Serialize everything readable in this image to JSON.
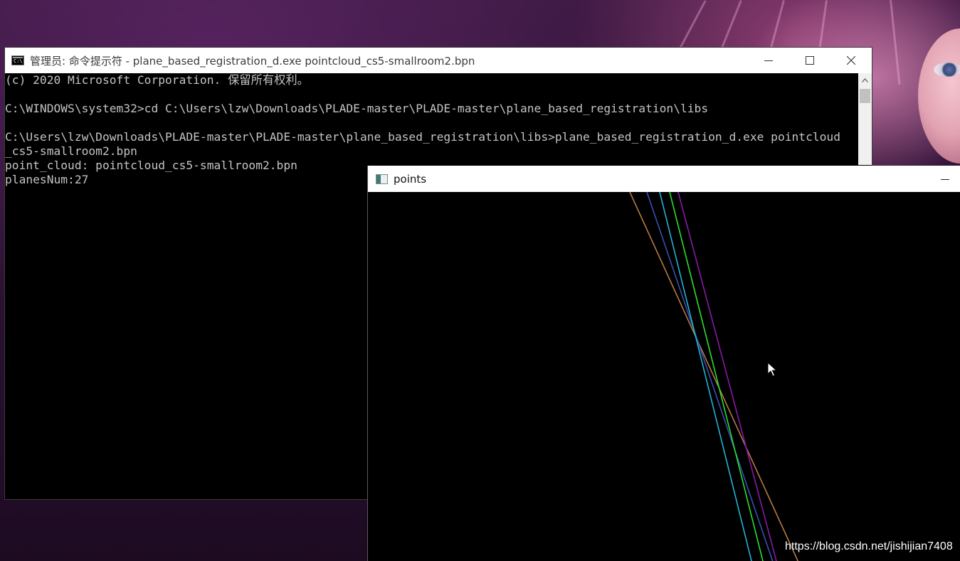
{
  "cmd_window": {
    "title": "管理员: 命令提示符 - plane_based_registration_d.exe  pointcloud_cs5-smallroom2.bpn",
    "icon_label": "C:\\",
    "lines": [
      "(c) 2020 Microsoft Corporation. 保留所有权利。",
      "",
      "C:\\WINDOWS\\system32>cd C:\\Users\\lzw\\Downloads\\PLADE-master\\PLADE-master\\plane_based_registration\\libs",
      "",
      "C:\\Users\\lzw\\Downloads\\PLADE-master\\PLADE-master\\plane_based_registration\\libs>plane_based_registration_d.exe pointcloud",
      "_cs5-smallroom2.bpn",
      "point_cloud: pointcloud_cs5-smallroom2.bpn",
      "planesNum:27"
    ]
  },
  "points_window": {
    "title": "points",
    "line_colors": [
      "#b87a45",
      "#3b4fb0",
      "#24b3d6",
      "#2be02b",
      "#8a1aa8"
    ]
  },
  "watermark": "https://blog.csdn.net/jishijian7408",
  "icons": {
    "minimize": "minimize-icon",
    "maximize": "maximize-icon",
    "close": "close-icon",
    "scroll_up": "chevron-up-icon",
    "cursor": "mouse-pointer-icon"
  }
}
